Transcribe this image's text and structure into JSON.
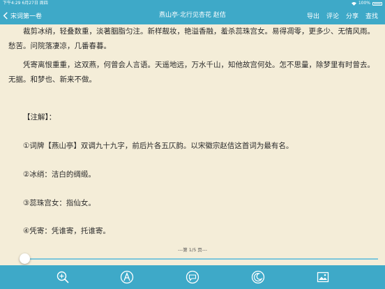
{
  "status_bar": {
    "time": "下午4:29",
    "date": "6月27日 周四",
    "battery": "100%"
  },
  "nav": {
    "back_label": "宋词第一卷",
    "title": "燕山亭·北行见杏花 赵佶",
    "actions": [
      "导出",
      "评论",
      "分享",
      "查找"
    ]
  },
  "content": {
    "para1": "裁剪冰绡，轻叠数重，淡著胭脂匀注。新样靓妆，艳溢香融，羞杀蕊珠宫女。易得凋零，更多少、无情风雨。愁苦。问院落凄凉，几番春暮。",
    "para2": "凭寄离恨重重，这双燕，何曾会人言语。天遥地远，万水千山，知他故宫何处。怎不思量，除梦里有时曾去。无据。和梦也、新来不做。",
    "notes_header": "【注解】：",
    "note1": "①词牌【燕山亭】双调九十九字，前后片各五仄韵。以宋徽宗赵佶这首词为最有名。",
    "note2": "②冰绡：洁白的绸缎。",
    "note3": "③蕊珠宫女：指仙女。",
    "note4": "④凭寄：凭谁寄，托谁寄。"
  },
  "page_indicator": "---第 1/5 页---",
  "reading_progress": 0.0,
  "toolbar_icons": [
    "zoom-icon",
    "font-icon",
    "comment-icon",
    "night-mode-icon",
    "image-icon"
  ],
  "colors": {
    "accent": "#3ea9c8",
    "page_background": "#f4edd8"
  }
}
